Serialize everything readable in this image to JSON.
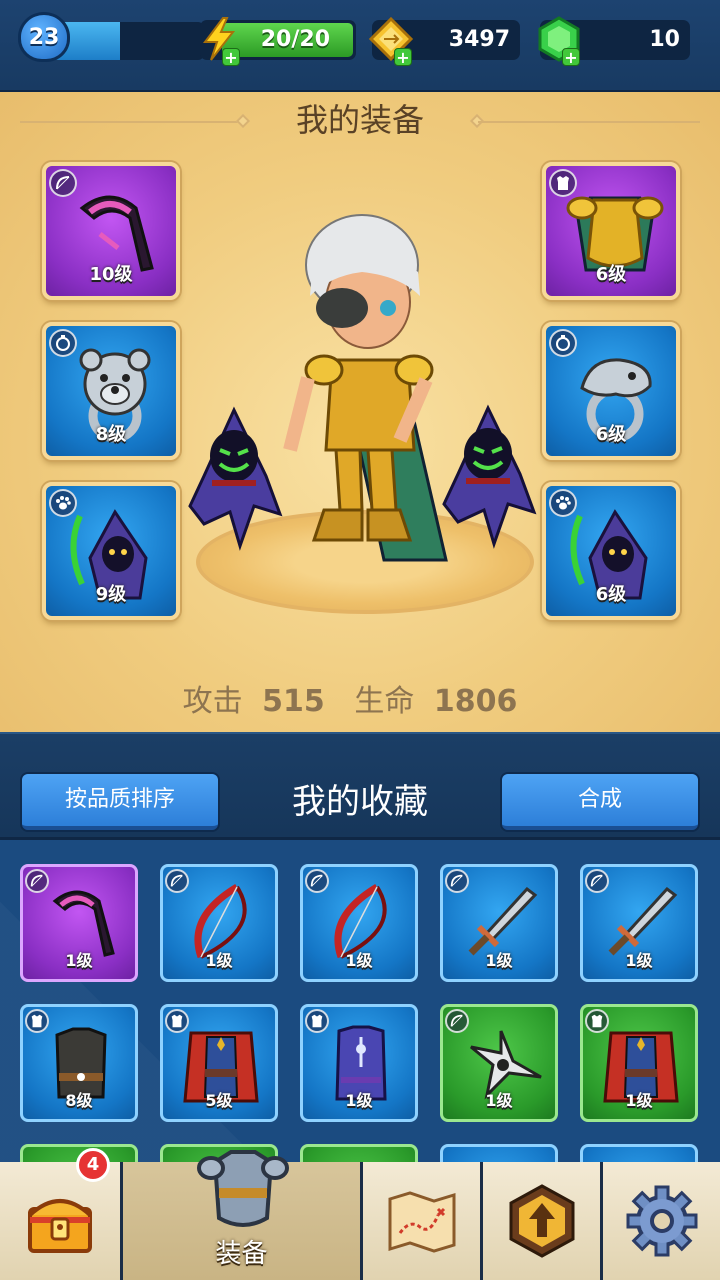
{
  "topbar": {
    "level": "23",
    "xp_progress": 0.45,
    "energy": "20/20",
    "gold": "3497",
    "gems": "10",
    "icons": [
      "lightning-icon",
      "gold-coin-icon",
      "green-gem-icon",
      "plus-icon"
    ]
  },
  "equipment": {
    "title": "我的装备",
    "slots": [
      {
        "type_icon": "bow-icon",
        "item": "pink-scythe",
        "level": "10级",
        "rarity": "purple"
      },
      {
        "type_icon": "armor-icon",
        "item": "golden-armor",
        "level": "6级",
        "rarity": "purple"
      },
      {
        "type_icon": "ring-icon",
        "item": "bear-ring",
        "level": "8级",
        "rarity": "blue"
      },
      {
        "type_icon": "ring-icon",
        "item": "serpent-ring",
        "level": "6级",
        "rarity": "blue"
      },
      {
        "type_icon": "paw-icon",
        "item": "reaper-pet",
        "level": "9级",
        "rarity": "blue"
      },
      {
        "type_icon": "paw-icon",
        "item": "reaper-pet",
        "level": "6级",
        "rarity": "blue"
      }
    ],
    "stats": {
      "attack_label": "攻击",
      "attack_value": "515",
      "hp_label": "生命",
      "hp_value": "1806"
    }
  },
  "collection": {
    "title": "我的收藏",
    "sort_button": "按品质排序",
    "merge_button": "合成",
    "items": [
      {
        "type_icon": "bow-icon",
        "item": "pink-scythe",
        "level": "1级",
        "rarity": "purple"
      },
      {
        "type_icon": "bow-icon",
        "item": "red-bow",
        "level": "1级",
        "rarity": "blue"
      },
      {
        "type_icon": "bow-icon",
        "item": "red-bow",
        "level": "1级",
        "rarity": "blue"
      },
      {
        "type_icon": "bow-icon",
        "item": "serrated-sword",
        "level": "1级",
        "rarity": "blue"
      },
      {
        "type_icon": "bow-icon",
        "item": "serrated-sword",
        "level": "1级",
        "rarity": "blue"
      },
      {
        "type_icon": "armor-icon",
        "item": "dark-vest",
        "level": "8级",
        "rarity": "blue"
      },
      {
        "type_icon": "armor-icon",
        "item": "red-robe",
        "level": "5级",
        "rarity": "blue"
      },
      {
        "type_icon": "armor-icon",
        "item": "mage-robe",
        "level": "1级",
        "rarity": "blue"
      },
      {
        "type_icon": "bow-icon",
        "item": "shuriken",
        "level": "1级",
        "rarity": "green"
      },
      {
        "type_icon": "armor-icon",
        "item": "red-robe",
        "level": "1级",
        "rarity": "green"
      }
    ]
  },
  "nav": {
    "badge_count": "4",
    "tabs": [
      {
        "name": "chest",
        "label": ""
      },
      {
        "name": "equipment",
        "label": "装备"
      },
      {
        "name": "map",
        "label": ""
      },
      {
        "name": "upgrade",
        "label": ""
      },
      {
        "name": "settings",
        "label": ""
      }
    ]
  }
}
